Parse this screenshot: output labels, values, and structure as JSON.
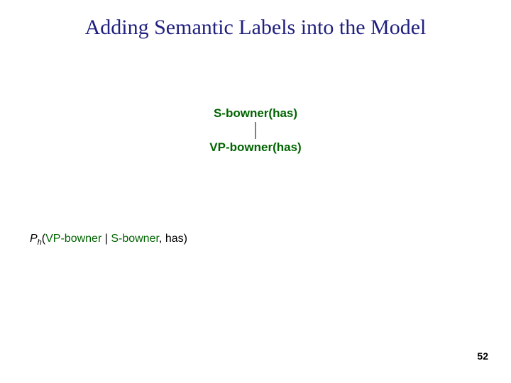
{
  "title": "Adding Semantic Labels into the Model",
  "tree": {
    "root": "S-bowner(has)",
    "child": "VP-bowner(has)"
  },
  "formula": {
    "P": "P",
    "sub": "h",
    "open": "(",
    "arg1": "VP-bowner",
    "sep1": " | ",
    "arg2": "S-bowner",
    "sep2": ", ",
    "arg3": "has",
    "close": ")"
  },
  "page_number": "52",
  "colors": {
    "title": "#20207f",
    "tree_node": "#006400",
    "formula_highlight": "#006400"
  }
}
